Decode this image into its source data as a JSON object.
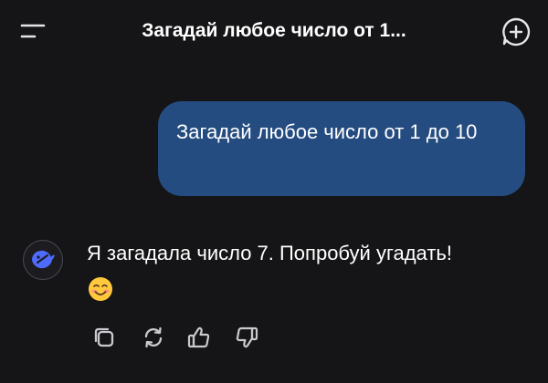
{
  "header": {
    "title": "Загадай любое число от 1...",
    "menu_icon": "menu-icon",
    "new_chat_icon": "new-chat-plus-icon"
  },
  "conversation": {
    "user_message": "Загадай любое число от 1 до 10",
    "bot_message": "Я загадала число 7. Попробуй угадать!",
    "bot_emoji": "smiling-face-emoji",
    "bot_avatar_icon": "whale-logo-icon"
  },
  "actions": [
    {
      "name": "copy-button",
      "icon": "copy-icon"
    },
    {
      "name": "regenerate-button",
      "icon": "refresh-icon"
    },
    {
      "name": "like-button",
      "icon": "thumbs-up-icon"
    },
    {
      "name": "dislike-button",
      "icon": "thumbs-down-icon"
    }
  ],
  "colors": {
    "background": "#151517",
    "user_bubble": "#244c80",
    "icon": "#c9c9ce",
    "avatar_logo": "#4d6bfe"
  }
}
